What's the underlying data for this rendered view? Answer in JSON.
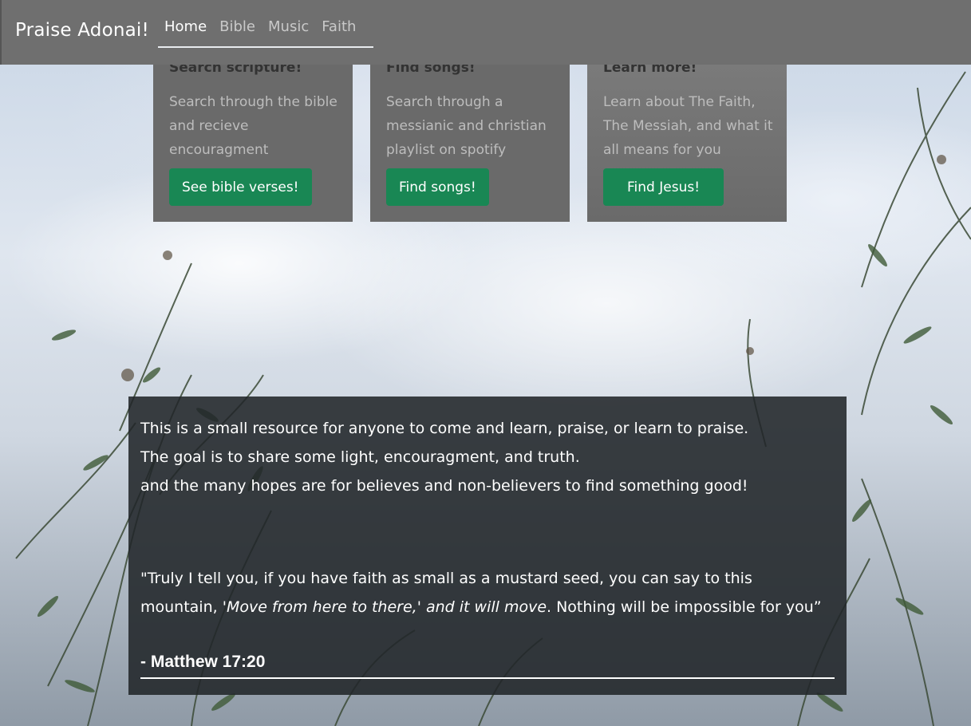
{
  "nav": {
    "brand": "Praise Adonai!",
    "links": [
      {
        "label": "Home",
        "active": true
      },
      {
        "label": "Bible",
        "active": false
      },
      {
        "label": "Music",
        "active": false
      },
      {
        "label": "Faith",
        "active": false
      }
    ]
  },
  "cards": [
    {
      "title": "Search scripture!",
      "text": "Search through the bible and recieve encouragment",
      "button": "See bible verses!"
    },
    {
      "title": "Find songs!",
      "text": "Search through a messianic and christian playlist on spotify",
      "button": "Find songs!"
    },
    {
      "title": "Learn more!",
      "text": "Learn about The Faith, The Messiah, and what it all means for you",
      "button": "Find Jesus!"
    }
  ],
  "info": {
    "intro_lines": [
      "This is a small resource for anyone to come and learn, praise, or learn to praise.",
      "The goal is to share some light, encouragment, and truth.",
      "and the many hopes are for believes and non-believers to find something good!"
    ],
    "quote_part1": "\"Truly I tell you, if you have faith as small as a mustard seed, you can say to this mountain, '",
    "quote_italic": "Move from here to there,' and it will move",
    "quote_part2": ". Nothing will be impossible for you”",
    "reference": "- Matthew 17:20"
  },
  "colors": {
    "navbar": "#6f6f6f",
    "card": "#6a6a6a",
    "button": "#198754",
    "panel": "#212529"
  }
}
